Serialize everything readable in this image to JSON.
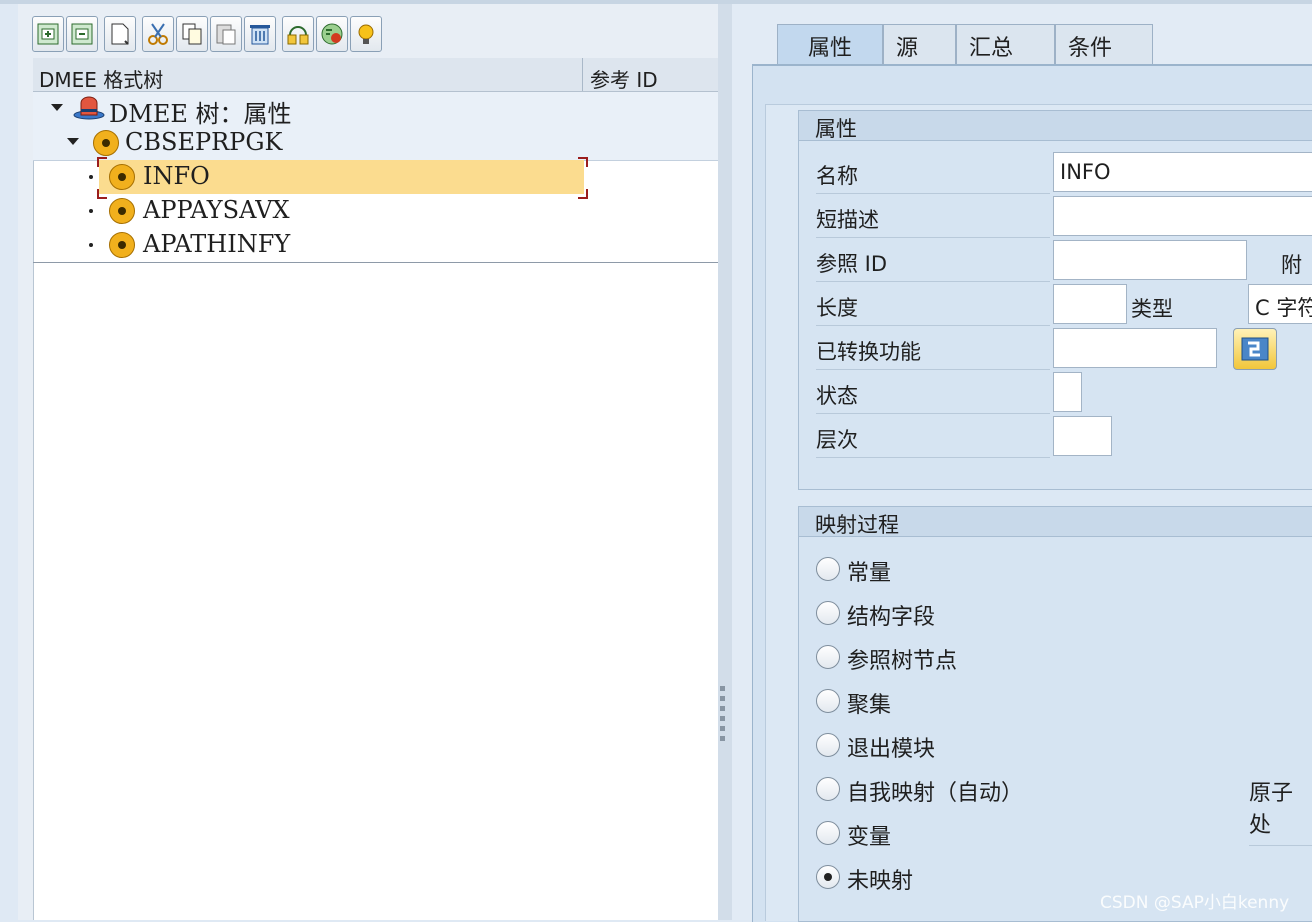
{
  "toolbar": {
    "icons": [
      "insert-subnode-icon",
      "insert-node-icon",
      "new-document-icon",
      "cut-icon",
      "copy-icon",
      "paste-icon",
      "delete-icon",
      "transport-icon",
      "check-icon",
      "info-bulb-icon"
    ]
  },
  "tree": {
    "col_format_tree": "DMEE 格式树",
    "col_ref_id": "参考 ID",
    "root_label": "DMEE 树：属性",
    "node_label": "CBSEPRPGK",
    "children": [
      "INFO",
      "APPAYSAVX",
      "APATHINFY"
    ],
    "selected_child": "INFO"
  },
  "tabs": [
    "属性",
    "源",
    "汇总",
    "条件"
  ],
  "active_tab": "属性",
  "attributes": {
    "title": "属性",
    "name_label": "名称",
    "name_value": "INFO",
    "shortdesc_label": "短描述",
    "shortdesc_value": "",
    "refid_label": "参照 ID",
    "refid_value": "",
    "attach_label": "附",
    "length_label": "长度",
    "length_value": "",
    "type_label": "类型",
    "type_value": "C 字符",
    "conv_label": "已转换功能",
    "conv_value": "",
    "status_label": "状态",
    "status_value": "",
    "level_label": "层次",
    "level_value": ""
  },
  "mapping": {
    "title": "映射过程",
    "options": [
      "常量",
      "结构字段",
      "参照树节点",
      "聚集",
      "退出模块",
      "自我映射（自动）",
      "变量",
      "未映射"
    ],
    "selected": "未映射",
    "atomic_label": "原子处"
  },
  "watermark": "CSDN @SAP小白kenny",
  "colors": {
    "selection": "#fbdc8f",
    "node": "#f1b01d",
    "tab_active": "#c2d8ee"
  }
}
